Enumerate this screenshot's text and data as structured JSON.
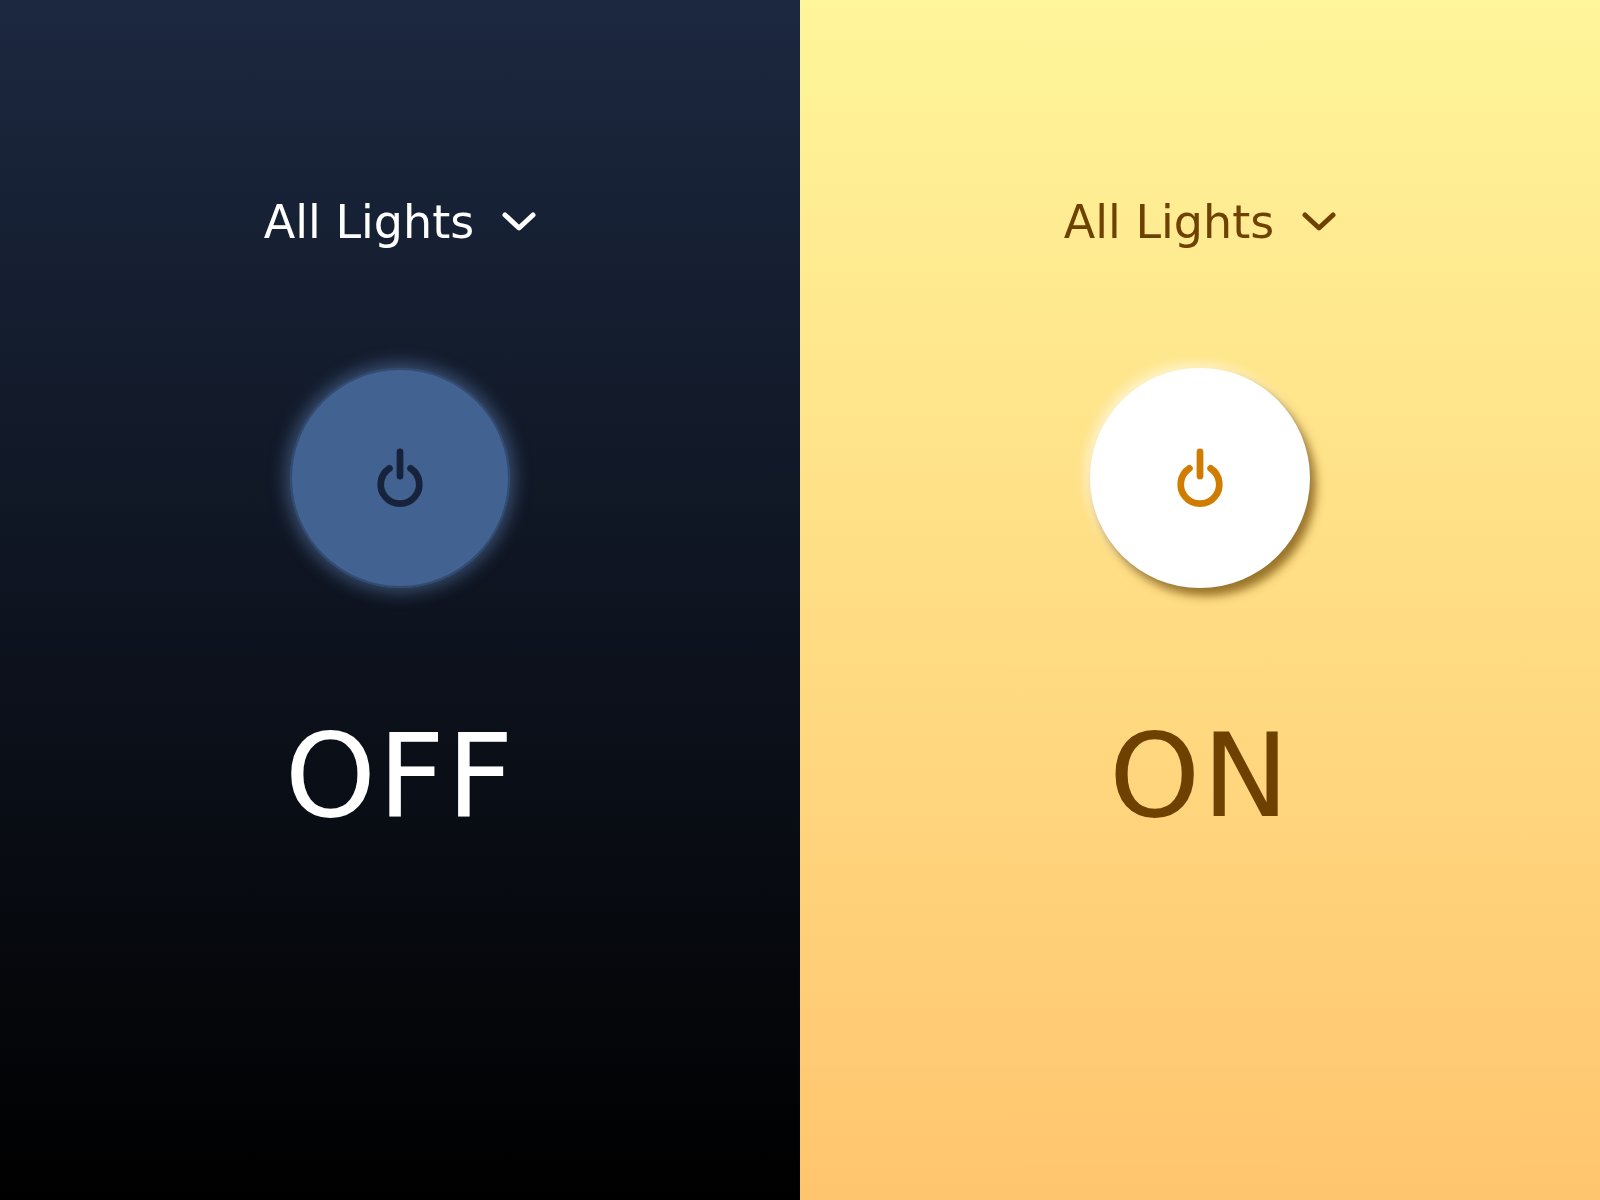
{
  "panels": [
    {
      "dropdown": {
        "label": "All Lights"
      },
      "power": {
        "on": false
      },
      "state_label": "OFF"
    },
    {
      "dropdown": {
        "label": "All Lights"
      },
      "power": {
        "on": true
      },
      "state_label": "ON"
    }
  ]
}
